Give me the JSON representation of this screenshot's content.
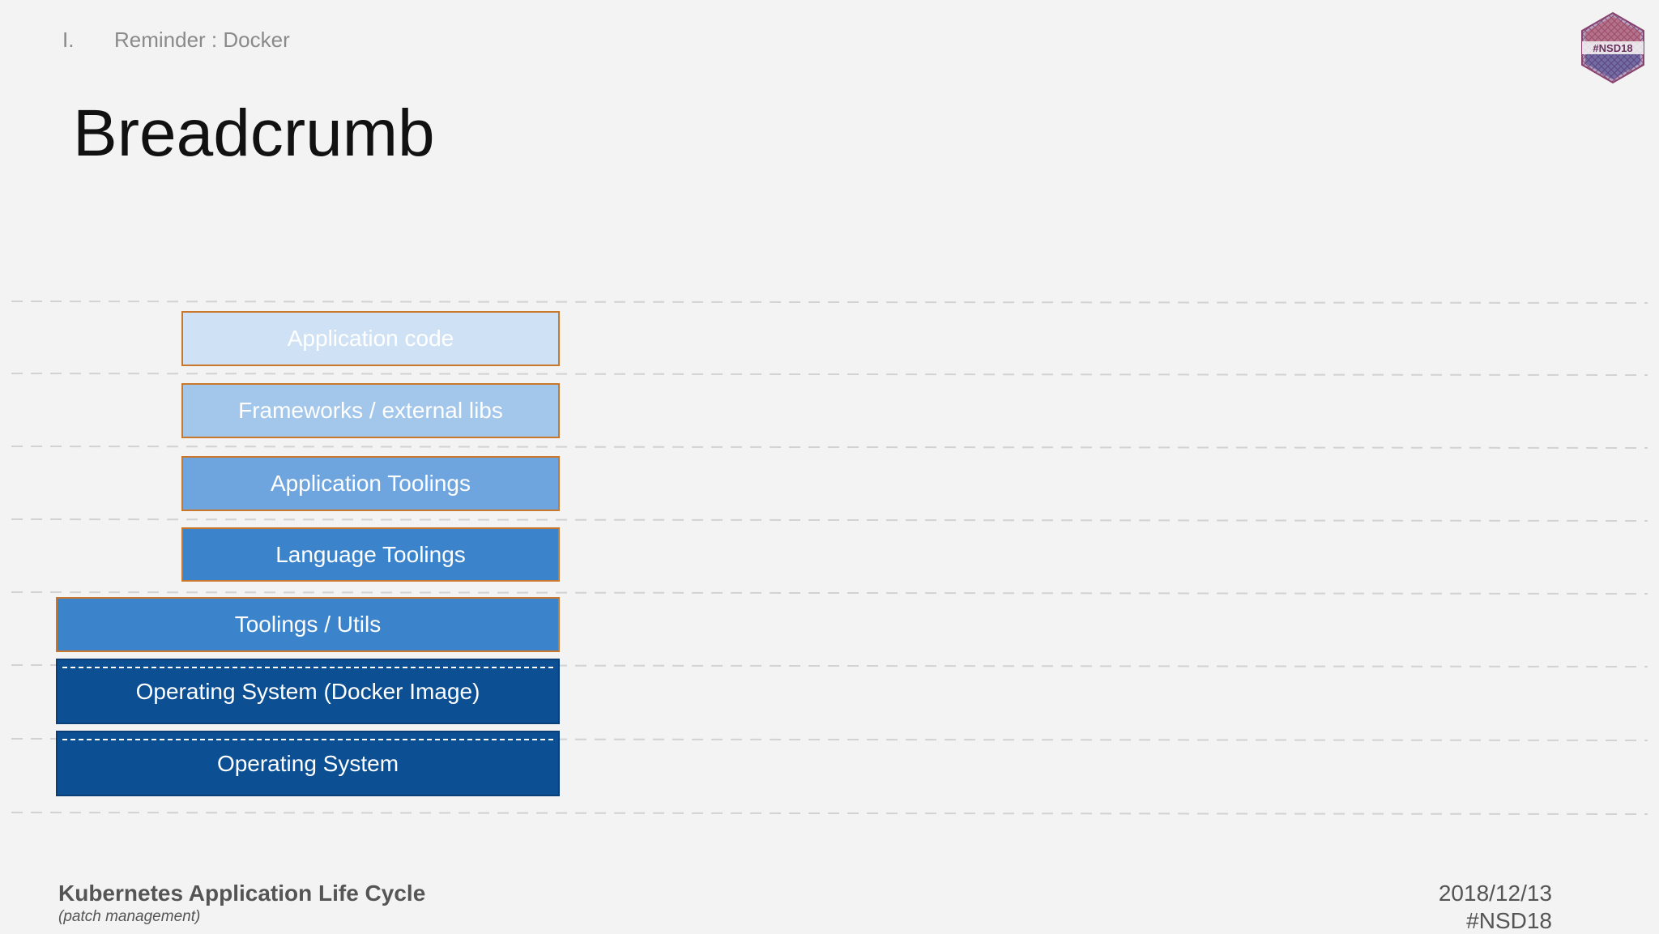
{
  "header": {
    "section_number": "I.",
    "section_title": "Reminder : Docker",
    "title": "Breadcrumb",
    "logo_text": "#NSD18"
  },
  "stack": {
    "layers": [
      {
        "label": "Application code",
        "fill": "#cfe2f5",
        "border": "#c8772b",
        "text_color": "#ffffff"
      },
      {
        "label": "Frameworks / external libs",
        "fill": "#a3c6eb",
        "border": "#c8772b",
        "text_color": "#ffffff"
      },
      {
        "label": "Application Toolings",
        "fill": "#6fa5de",
        "border": "#c8772b",
        "text_color": "#ffffff"
      },
      {
        "label": "Language Toolings",
        "fill": "#3b83cb",
        "border": "#c8772b",
        "text_color": "#ffffff"
      },
      {
        "label": "Toolings / Utils",
        "fill": "#3b83cb",
        "border": "#c8772b",
        "text_color": "#ffffff"
      },
      {
        "label": "Operating System (Docker Image)",
        "fill": "#0c4f93",
        "border": "#0a3f77",
        "text_color": "#ffffff"
      },
      {
        "label": "Operating System",
        "fill": "#0c4f93",
        "border": "#0a3f77",
        "text_color": "#ffffff"
      }
    ]
  },
  "footer": {
    "title": "Kubernetes Application Life Cycle",
    "subtitle": "(patch management)",
    "date": "2018/12/13",
    "tag": "#NSD18"
  }
}
